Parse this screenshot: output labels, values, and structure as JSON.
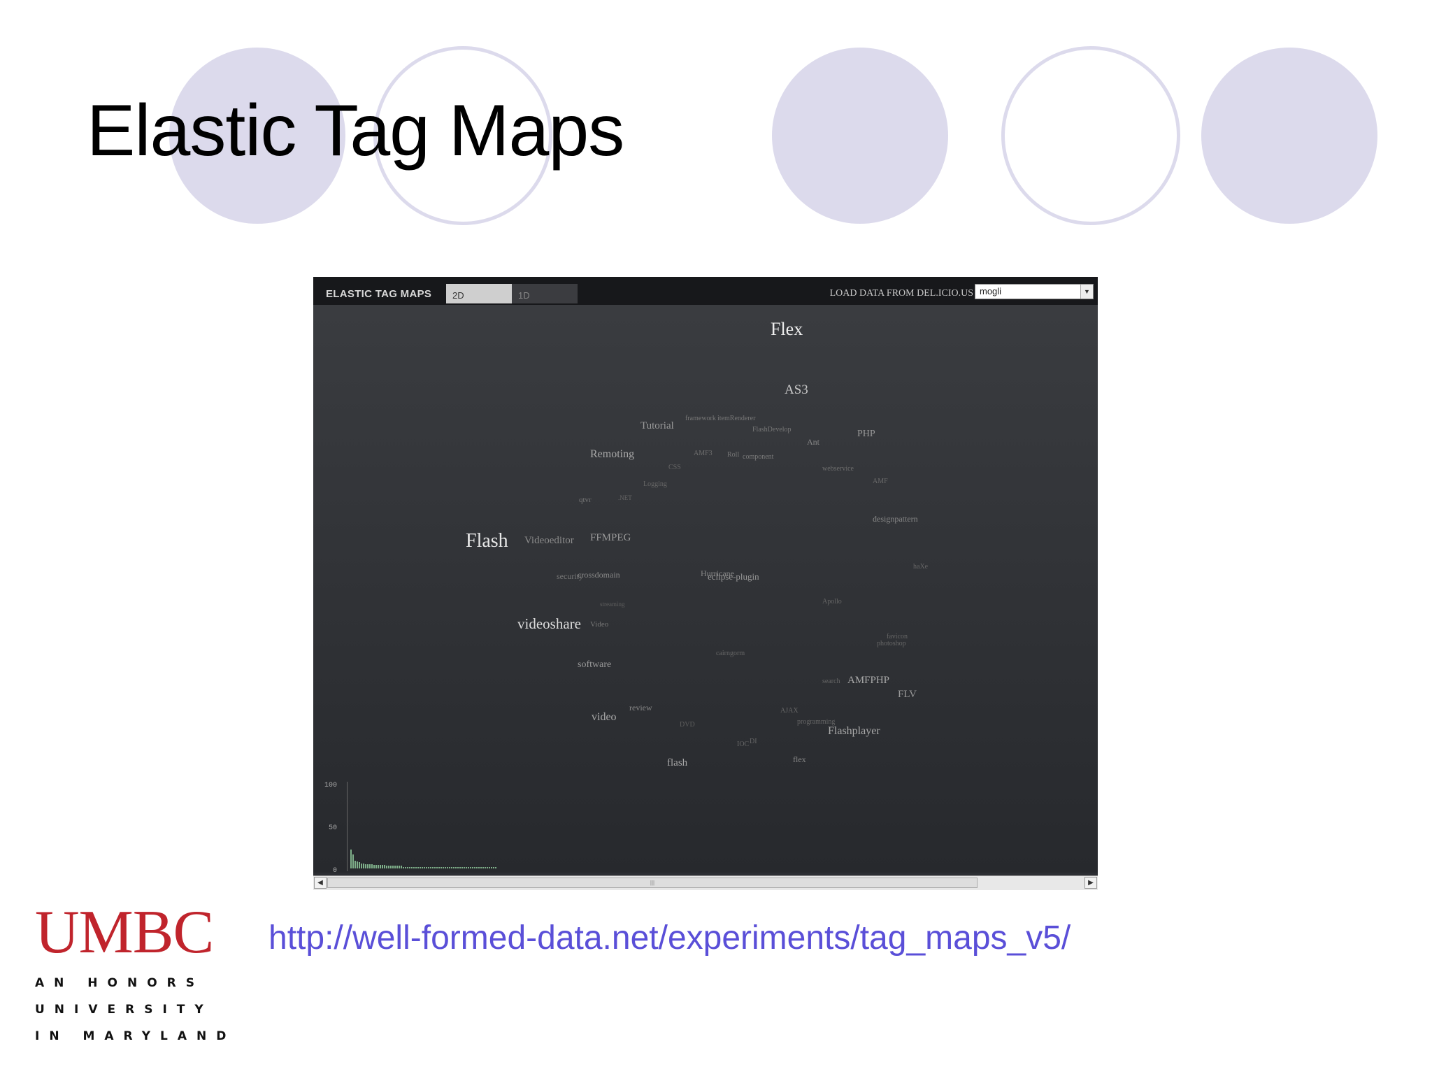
{
  "slide": {
    "title": "Elastic Tag Maps",
    "url": "http://well-formed-data.net/experiments/tag_maps_v5/"
  },
  "app": {
    "title": "ELASTIC TAG MAPS",
    "tabs": [
      {
        "label": "2D",
        "active": true
      },
      {
        "label": "1D",
        "active": false
      }
    ],
    "load_label": "LOAD DATA FROM DEL.ICIO.US",
    "dataset_select": {
      "value": "mogli"
    }
  },
  "tags": [
    {
      "text": "Flex",
      "size": "large"
    },
    {
      "text": "AS3",
      "size": "medium"
    },
    {
      "text": "framework",
      "size": "tiny"
    },
    {
      "text": "itemRenderer",
      "size": "tiny"
    },
    {
      "text": "FlashDevelop",
      "size": "tiny"
    },
    {
      "text": "Tutorial",
      "size": "small"
    },
    {
      "text": "Ant",
      "size": "tiny"
    },
    {
      "text": "PHP",
      "size": "small"
    },
    {
      "text": "Remoting",
      "size": "small"
    },
    {
      "text": "AMF3",
      "size": "tiny"
    },
    {
      "text": "Roll",
      "size": "tiny"
    },
    {
      "text": "component",
      "size": "tiny"
    },
    {
      "text": "CSS",
      "size": "tiny"
    },
    {
      "text": "webservice",
      "size": "tiny"
    },
    {
      "text": "AMF",
      "size": "tiny"
    },
    {
      "text": "Logging",
      "size": "tiny"
    },
    {
      "text": "qtvr",
      "size": "tiny"
    },
    {
      "text": ".NET",
      "size": "tiny"
    },
    {
      "text": "designpattern",
      "size": "tiny"
    },
    {
      "text": "Flash",
      "size": "large"
    },
    {
      "text": "Videoeditor",
      "size": "small"
    },
    {
      "text": "FFMPEG",
      "size": "small"
    },
    {
      "text": "security",
      "size": "tiny"
    },
    {
      "text": "crossdomain",
      "size": "tiny"
    },
    {
      "text": "Hurricane",
      "size": "tiny"
    },
    {
      "text": "eclipse-plugin",
      "size": "tiny"
    },
    {
      "text": "haXe",
      "size": "tiny"
    },
    {
      "text": "streaming",
      "size": "tiny"
    },
    {
      "text": "Apollo",
      "size": "tiny"
    },
    {
      "text": "videoshare",
      "size": "medium"
    },
    {
      "text": "Video",
      "size": "tiny"
    },
    {
      "text": "favicon",
      "size": "tiny"
    },
    {
      "text": "photoshop",
      "size": "tiny"
    },
    {
      "text": "cairngorm",
      "size": "tiny"
    },
    {
      "text": "software",
      "size": "small"
    },
    {
      "text": "search",
      "size": "tiny"
    },
    {
      "text": "AMFPHP",
      "size": "small"
    },
    {
      "text": "FLV",
      "size": "small"
    },
    {
      "text": "review",
      "size": "small"
    },
    {
      "text": "AJAX",
      "size": "tiny"
    },
    {
      "text": "video",
      "size": "small"
    },
    {
      "text": "DVD",
      "size": "tiny"
    },
    {
      "text": "programming",
      "size": "tiny"
    },
    {
      "text": "Flashplayer",
      "size": "small"
    },
    {
      "text": "IOC",
      "size": "tiny"
    },
    {
      "text": "DI",
      "size": "tiny"
    },
    {
      "text": "flash",
      "size": "small"
    },
    {
      "text": "flex",
      "size": "small"
    }
  ],
  "histogram": {
    "y_labels": [
      "100",
      "50",
      "0"
    ],
    "bar_values": [
      22,
      16,
      9,
      8,
      7,
      6,
      6,
      5,
      5,
      5,
      5,
      4,
      4,
      4,
      4,
      4,
      4,
      3,
      3,
      3,
      3,
      3,
      3,
      3,
      3,
      2,
      2,
      2,
      2,
      2,
      2,
      2,
      2,
      2,
      2,
      2,
      2,
      2,
      2,
      2,
      2,
      2,
      2,
      2,
      2,
      2,
      2,
      2,
      2,
      2,
      2,
      2,
      2,
      2,
      2,
      2,
      2,
      2,
      2,
      2,
      2,
      2,
      2,
      2,
      2,
      2,
      2,
      2,
      2,
      2
    ]
  },
  "logo": {
    "word": "UMBC",
    "lines": [
      "AN HONORS",
      "UNIVERSITY",
      "IN MARYLAND"
    ]
  },
  "colors": {
    "circle": "#dcdaec",
    "link": "#5a4fd8",
    "umbc_red": "#c0242c"
  }
}
